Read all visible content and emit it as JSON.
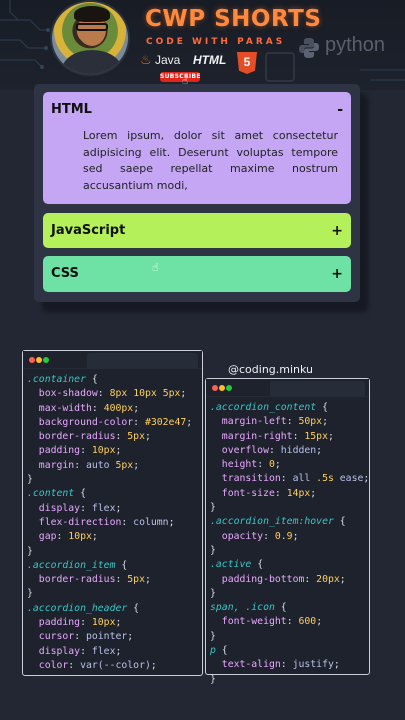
{
  "banner": {
    "title": "CWP SHORTS",
    "subtitle": "CODE WITH PARAS",
    "java_label": "Java",
    "html_label": "HTML",
    "html5_badge": "5",
    "subscribe_label": "SUBSCRIBE",
    "python_label": "python",
    "title_color": "#ff8a3d"
  },
  "accordion": {
    "items": [
      {
        "title": "HTML",
        "sign": "-",
        "body": "Lorem ipsum, dolor sit amet consectetur adipisicing elit. Deserunt voluptas tempore sed saepe repellat maxime nostrum accusantium modi,",
        "color": "#c4a6f5",
        "open": true
      },
      {
        "title": "JavaScript",
        "sign": "+",
        "color": "#b4f05a",
        "open": false
      },
      {
        "title": "CSS",
        "sign": "+",
        "color": "#6ee2a4",
        "open": false
      }
    ]
  },
  "handle": "@coding.minku",
  "code_left": [
    ".container {",
    "  box-shadow: 8px 10px 5px;",
    "  max-width: 400px;",
    "  background-color: #302e47;",
    "  border-radius: 5px;",
    "  padding: 10px;",
    "  margin: auto 5px;",
    "}",
    ".content {",
    "  display: flex;",
    "  flex-direction: column;",
    "  gap: 10px;",
    "}",
    ".accordion_item {",
    "  border-radius: 5px;",
    "}",
    ".accordion_header {",
    "  padding: 10px;",
    "  cursor: pointer;",
    "  display: flex;",
    "  color: var(--color);"
  ],
  "code_right": [
    ".accordion_content {",
    "  margin-left: 50px;",
    "  margin-right: 15px;",
    "  overflow: hidden;",
    "  height: 0;",
    "  transition: all .5s ease;",
    "  font-size: 14px;",
    "}",
    ".accordion_item:hover {",
    "  opacity: 0.9;",
    "}",
    ".active {",
    "  padding-bottom: 20px;",
    "}",
    "span, .icon {",
    "  font-weight: 600;",
    "}",
    "p {",
    "  text-align: justify;",
    "}"
  ]
}
